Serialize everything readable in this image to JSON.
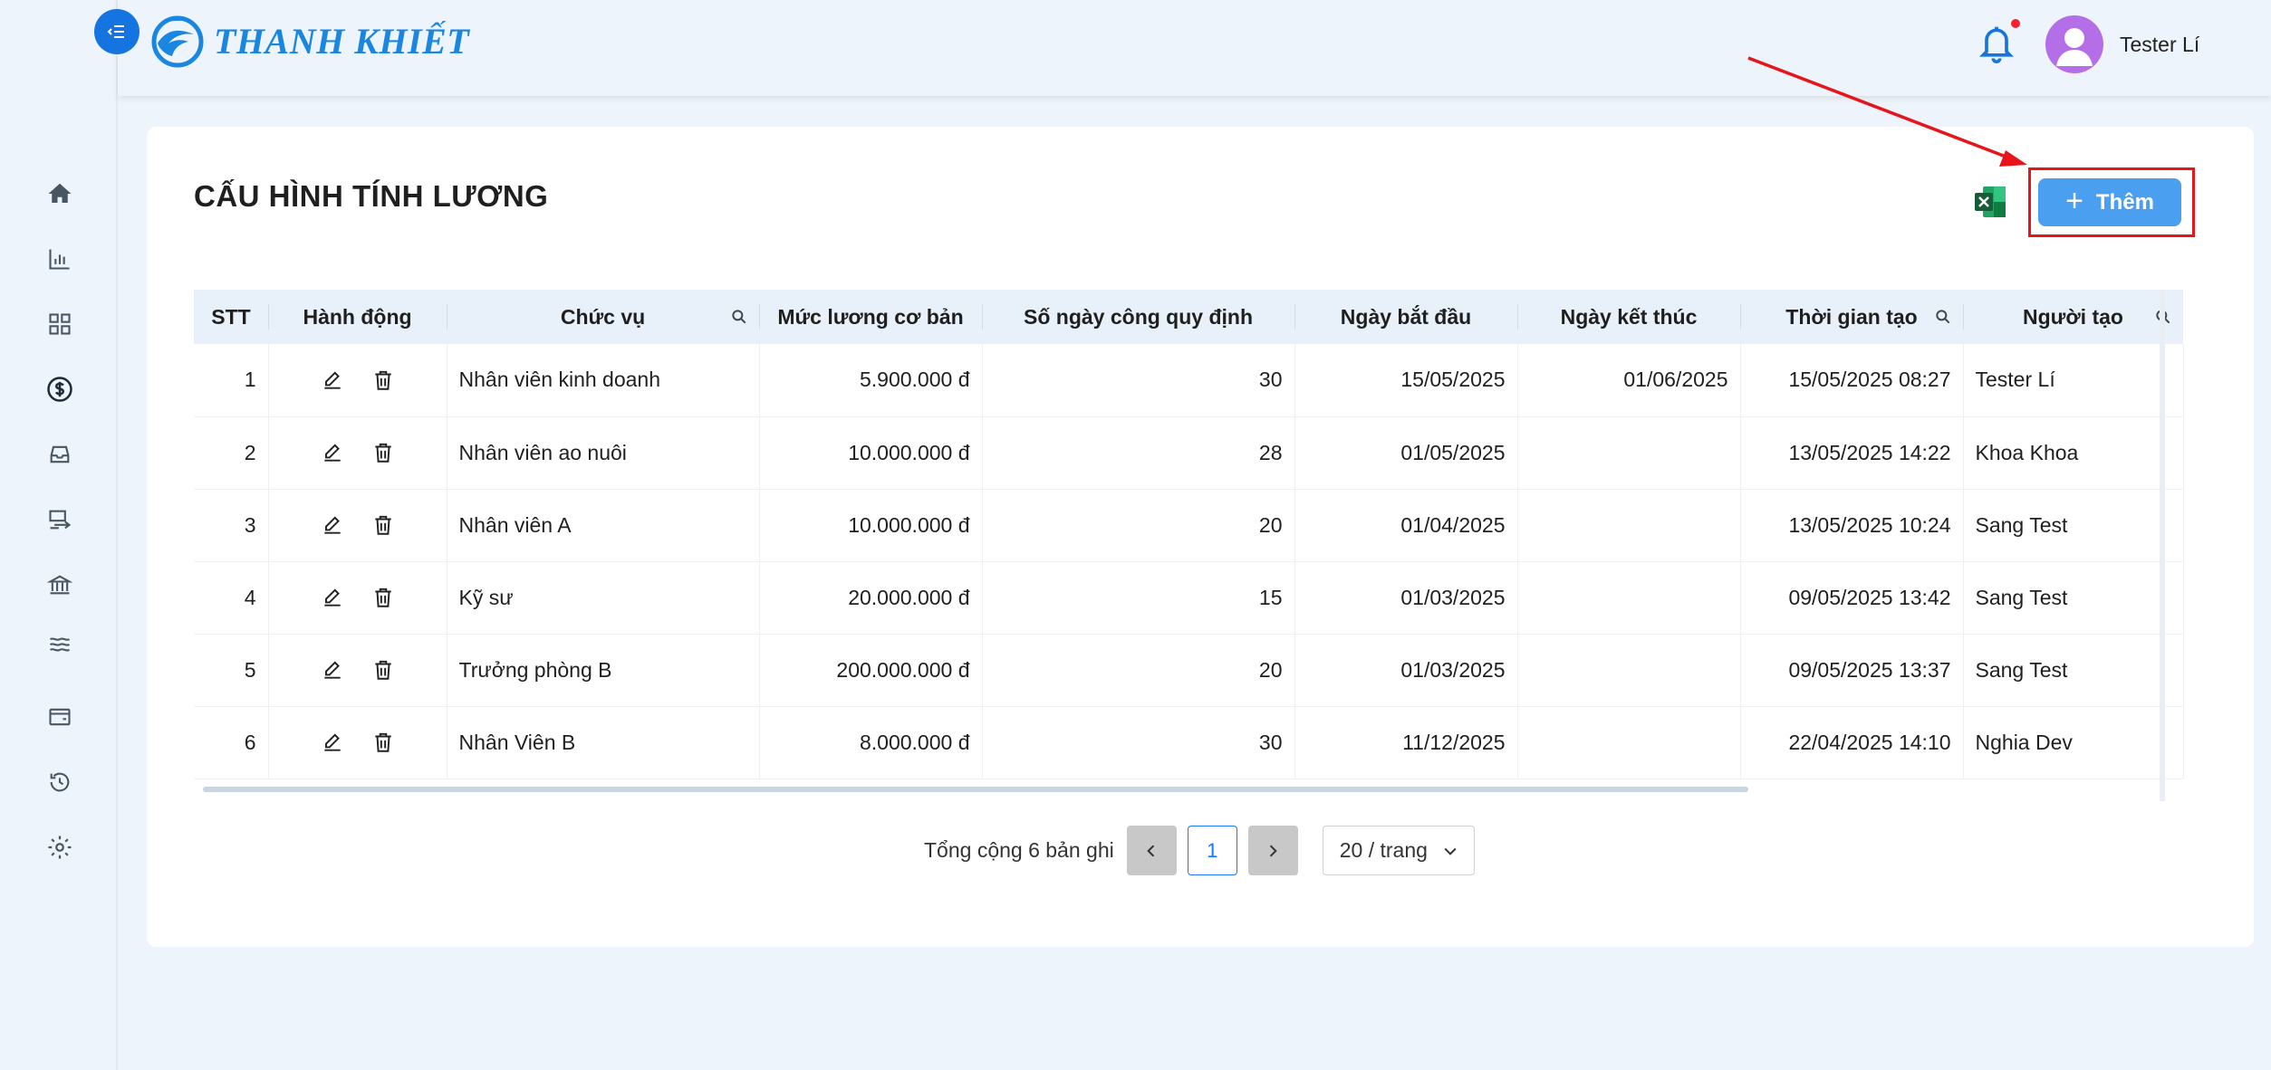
{
  "app": {
    "brand": "THANH KHIẾT",
    "user_name": "Tester Lí"
  },
  "sidebar": {
    "items": [
      {
        "icon": "home-icon"
      },
      {
        "icon": "bar-chart-icon"
      },
      {
        "icon": "grid-icon"
      },
      {
        "icon": "dollar-icon"
      },
      {
        "icon": "inbox-icon"
      },
      {
        "icon": "transfer-icon"
      },
      {
        "icon": "bank-icon"
      },
      {
        "icon": "waves-icon"
      },
      {
        "icon": "wallet-icon"
      },
      {
        "icon": "history-icon"
      },
      {
        "icon": "gear-icon"
      }
    ]
  },
  "page": {
    "title": "CẤU HÌNH TÍNH LƯƠNG",
    "add_label": "Thêm"
  },
  "table": {
    "columns": [
      "STT",
      "Hành động",
      "Chức vụ",
      "Mức lương cơ bản",
      "Số ngày công quy định",
      "Ngày bắt đầu",
      "Ngày kết thúc",
      "Thời gian tạo",
      "Người tạo"
    ],
    "rows": [
      {
        "stt": "1",
        "position": "Nhân viên kinh doanh",
        "salary": "5.900.000 đ",
        "days": "30",
        "start": "15/05/2025",
        "end": "01/06/2025",
        "created": "15/05/2025 08:27",
        "creator": "Tester Lí"
      },
      {
        "stt": "2",
        "position": "Nhân viên ao nuôi",
        "salary": "10.000.000 đ",
        "days": "28",
        "start": "01/05/2025",
        "end": "",
        "created": "13/05/2025 14:22",
        "creator": "Khoa Khoa"
      },
      {
        "stt": "3",
        "position": "Nhân viên A",
        "salary": "10.000.000 đ",
        "days": "20",
        "start": "01/04/2025",
        "end": "",
        "created": "13/05/2025 10:24",
        "creator": "Sang Test"
      },
      {
        "stt": "4",
        "position": "Kỹ sư",
        "salary": "20.000.000 đ",
        "days": "15",
        "start": "01/03/2025",
        "end": "",
        "created": "09/05/2025 13:42",
        "creator": "Sang Test"
      },
      {
        "stt": "5",
        "position": "Trưởng phòng B",
        "salary": "200.000.000 đ",
        "days": "20",
        "start": "01/03/2025",
        "end": "",
        "created": "09/05/2025 13:37",
        "creator": "Sang Test"
      },
      {
        "stt": "6",
        "position": "Nhân Viên B",
        "salary": "8.000.000 đ",
        "days": "30",
        "start": "11/12/2025",
        "end": "",
        "created": "22/04/2025 14:10",
        "creator": "Nghia Dev"
      }
    ]
  },
  "pagination": {
    "total_text": "Tổng cộng 6 bản ghi",
    "current_page": "1",
    "page_size": "20 / trang"
  },
  "colors": {
    "accent": "#1674e0",
    "button": "#4a9ff0",
    "highlight": "#e8141c"
  }
}
